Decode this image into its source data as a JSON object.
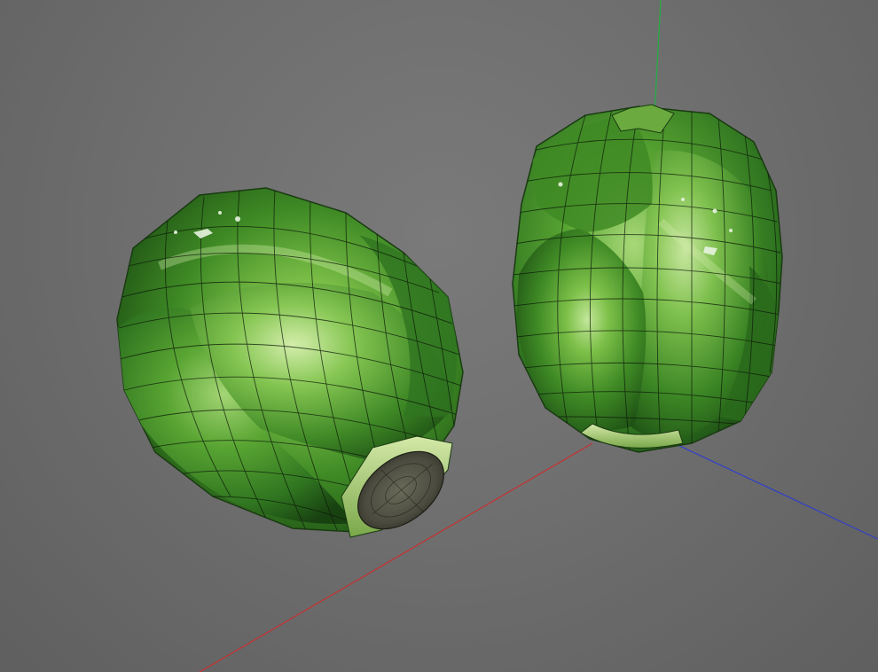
{
  "scene": {
    "background": "#6e6e6e",
    "axes": {
      "x_color": "#c83030",
      "y_color": "#22b040",
      "z_color": "#3040c8"
    },
    "objects": [
      {
        "name": "brussels-sprout-lying",
        "color_dark": "#1f5a16",
        "color_mid": "#4f9a2e",
        "color_light": "#c9eaa0"
      },
      {
        "name": "brussels-sprout-upright",
        "color_dark": "#1f5a16",
        "color_mid": "#4f9a2e",
        "color_light": "#c9eaa0"
      }
    ],
    "wireframe_color": "#0d1a0a"
  }
}
